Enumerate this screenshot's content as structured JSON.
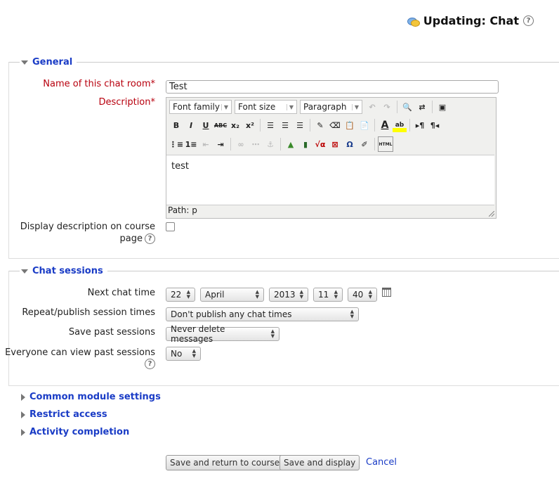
{
  "header": {
    "title": "Updating: Chat"
  },
  "general": {
    "legend": "General",
    "name_label": "Name of this chat room",
    "name_value": "Test",
    "description_label": "Description",
    "editor": {
      "font_family": "Font family",
      "font_size": "Font size",
      "format": "Paragraph",
      "content": "test",
      "path": "Path: p"
    },
    "display_desc_label_line1": "Display description on course",
    "display_desc_label_line2": "page",
    "required_marker": "*"
  },
  "sessions": {
    "legend": "Chat sessions",
    "next_time_label": "Next chat time",
    "day": "22",
    "month": "April",
    "year": "2013",
    "hour": "11",
    "minute": "40",
    "repeat_label": "Repeat/publish session times",
    "repeat_value": "Don't publish any chat times",
    "save_past_label": "Save past sessions",
    "save_past_value": "Never delete messages",
    "everyone_label": "Everyone can view past sessions",
    "everyone_value": "No"
  },
  "collapsed": {
    "common": "Common module settings",
    "restrict": "Restrict access",
    "completion": "Activity completion"
  },
  "actions": {
    "save_return": "Save and return to course",
    "save_display": "Save and display",
    "cancel": "Cancel"
  },
  "colors": {
    "link": "#1a3cc6",
    "required": "#b8000e"
  }
}
